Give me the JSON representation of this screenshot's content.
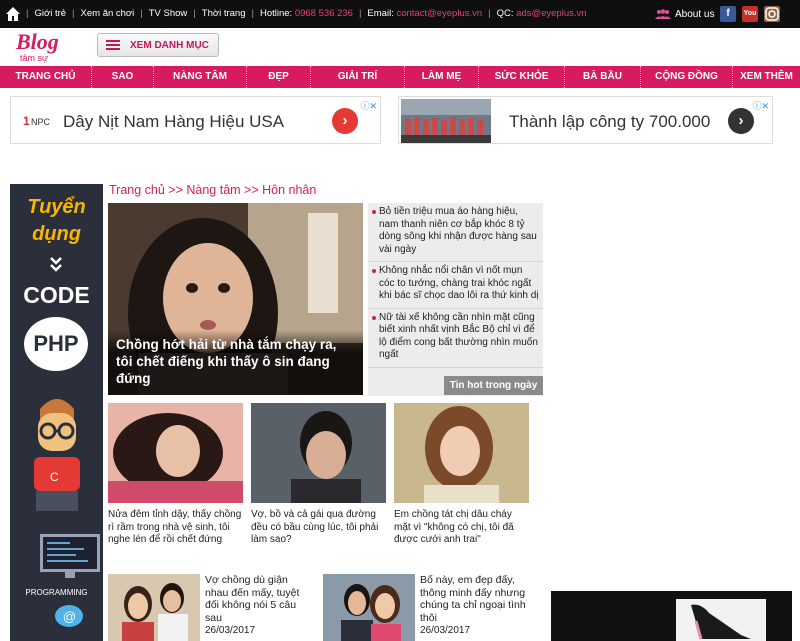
{
  "topbar": {
    "links": [
      "Giới trẻ",
      "Xem ăn chơi",
      "TV Show",
      "Thời trang"
    ],
    "hotline_label": "Hotline:",
    "hotline_value": "0968 536 236",
    "email_label": "Email:",
    "email_value": "contact@eyeplus.vn",
    "qc_label": "QC:",
    "qc_value": "ads@eyeplus.vn",
    "about_label": "About us",
    "social": [
      "facebook-icon",
      "youtube-icon",
      "instagram-icon"
    ]
  },
  "header": {
    "logo_text": "Blog",
    "logo_sub": "tâm sự",
    "category_button": "XEM DANH MỤC"
  },
  "nav": [
    "TRANG CHỦ",
    "SAO",
    "NÀNG TÂM",
    "ĐẸP",
    "GIẢI TRÍ",
    "LÀM MẸ",
    "SỨC KHỎE",
    "BÀ BẦU",
    "CỘNG ĐỒNG",
    "XEM THÊM"
  ],
  "ads": [
    {
      "brand": "NPC",
      "text": "Dây Nịt Nam Hàng Hiệu USA"
    },
    {
      "text": "Thành lập công ty 700.000"
    }
  ],
  "banner": {
    "line1": "Tuyển",
    "line2": "dụng",
    "code": "CODE",
    "php": "PHP",
    "programming": "PROGRAMMING"
  },
  "breadcrumb": "Trang chủ >> Nàng tâm >> Hôn nhân",
  "featured": {
    "title": "Chồng hớt hải từ nhà tắm chạy ra, tôi chết điếng khi thấy ô sin đang đứng"
  },
  "hot_list": {
    "label": "Tin hot trong ngày",
    "items": [
      "Bỏ tiền triệu mua áo hàng hiệu, nam thanh niên cơ bắp khóc 8 tỷ dòng sông khi nhận được hàng sau vài ngày",
      "Không nhắc nổi chân vì nốt mụn cóc to tướng, chàng trai khóc ngất khi bác sĩ chọc dao lôi ra thứ kinh dị",
      "Nữ tài xế không cần nhìn mặt cũng biết xinh nhất vịnh Bắc Bộ chỉ vì để lộ điểm cong bất thường nhìn muốn ngất"
    ]
  },
  "grid": [
    {
      "title": "Nửa đêm tỉnh dậy, thấy chồng rì rầm trong nhà vệ sinh, tôi nghe lén để rồi chết đứng"
    },
    {
      "title": "Vợ, bồ và cả gái qua đường đều có bầu cùng lúc, tôi phải làm sao?"
    },
    {
      "title": "Em chồng tát chị dâu cháy mặt vì \"không có chị, tôi đã được cưới anh trai\""
    }
  ],
  "bottom": [
    {
      "title": "Vợ chồng dù giận nhau đến mấy, tuyệt đối không nói 5 câu sau",
      "date": "26/03/2017"
    },
    {
      "title": "Bố này, em đẹp đấy, thông minh đấy nhưng chúng ta chỉ ngoại tình thôi",
      "date": "26/03/2017"
    }
  ],
  "colors": {
    "brand": "#d81b60",
    "topbar": "#0f0f0f",
    "banner": "#2b2f3c"
  }
}
